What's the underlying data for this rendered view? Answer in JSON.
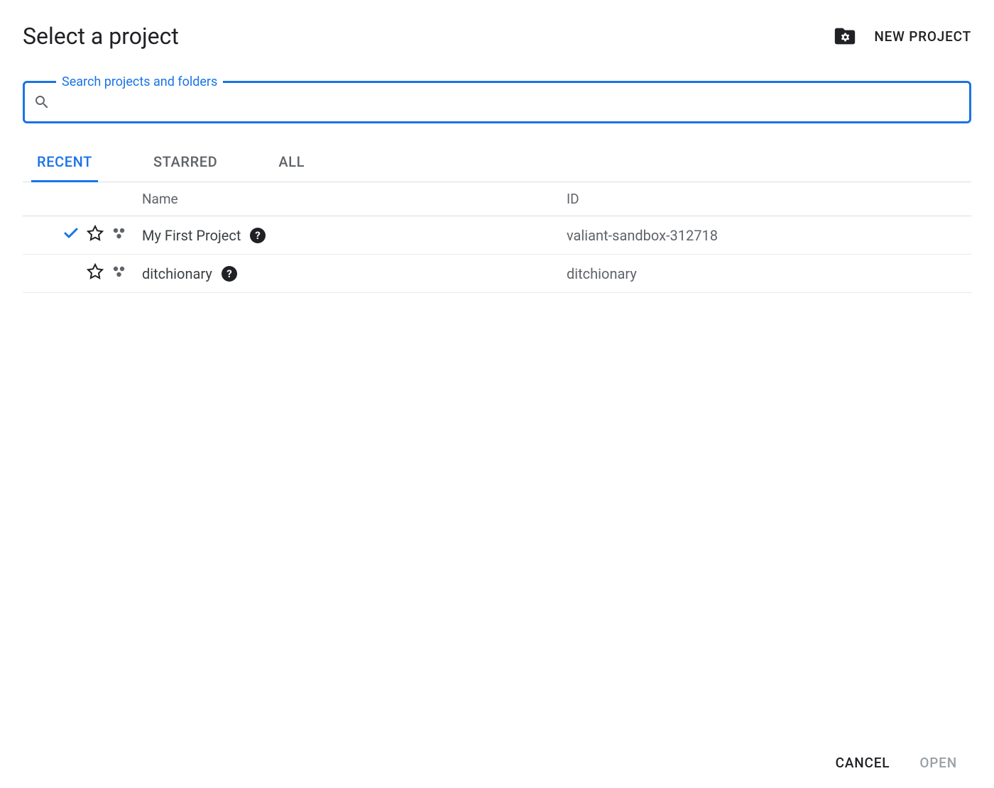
{
  "header": {
    "title": "Select a project",
    "new_project_label": "NEW PROJECT"
  },
  "search": {
    "label": "Search projects and folders",
    "value": ""
  },
  "tabs": {
    "recent": "RECENT",
    "starred": "STARRED",
    "all": "ALL",
    "active": "recent"
  },
  "table": {
    "columns": {
      "name": "Name",
      "id": "ID"
    },
    "rows": [
      {
        "selected": true,
        "starred": false,
        "name": "My First Project",
        "id": "valiant-sandbox-312718"
      },
      {
        "selected": false,
        "starred": false,
        "name": "ditchionary",
        "id": "ditchionary"
      }
    ]
  },
  "footer": {
    "cancel": "CANCEL",
    "open": "OPEN"
  },
  "colors": {
    "primary": "#1a73e8",
    "text": "#202124",
    "muted": "#5f6368"
  }
}
